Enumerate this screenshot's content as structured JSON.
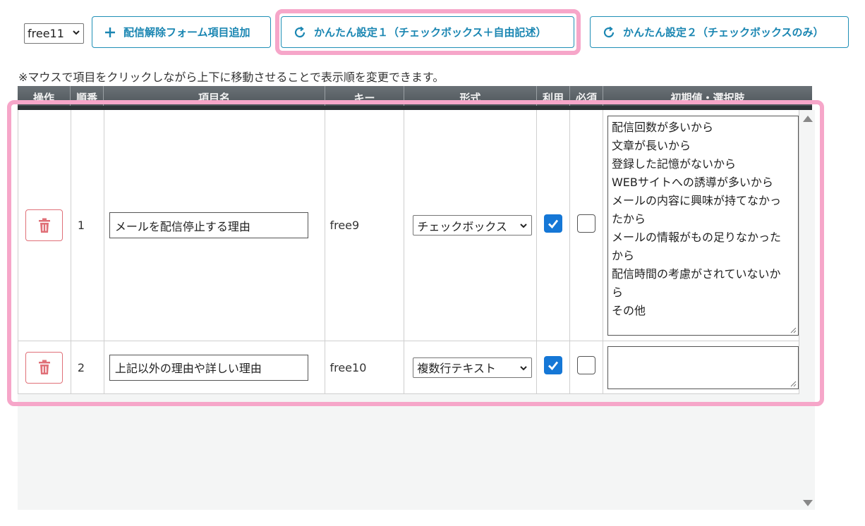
{
  "toolbar": {
    "field_select_value": "free11",
    "add_button_label": "配信解除フォーム項目追加",
    "easy1_button_label": "かんたん設定１（チェックボックス＋自由記述）",
    "easy2_button_label": "かんたん設定２（チェックボックスのみ）"
  },
  "note": "※マウスで項目をクリックしながら上下に移動させることで表示順を変更できます。",
  "table": {
    "headers": {
      "op": "操作",
      "no": "順番",
      "name": "項目名",
      "key": "キー",
      "type": "形式",
      "use": "利用",
      "required": "必須",
      "initial": "初期値・選択肢"
    },
    "rows": [
      {
        "no": "1",
        "name": "メールを配信停止する理由",
        "key": "free9",
        "type": "チェックボックス",
        "use": true,
        "required": false,
        "initial_lines": [
          "配信回数が多いから",
          "文章が長いから",
          "登録した記憶がないから",
          "WEBサイトへの誘導が多いから",
          "メールの内容に興味が持てなかっ",
          "たから",
          "メールの情報がもの足りなかった",
          "から",
          "配信時間の考慮がされていないか",
          "ら",
          "その他"
        ]
      },
      {
        "no": "2",
        "name": "上記以外の理由や詳しい理由",
        "key": "free10",
        "type": "複数行テキスト",
        "use": true,
        "required": false,
        "initial_lines": []
      }
    ]
  },
  "colors": {
    "accent": "#1a86b2",
    "highlight": "#f6a6c9",
    "delete": "#e07078",
    "checkbox": "#1577d6",
    "header": "#5a6166"
  },
  "icons": {
    "add": "plus-icon",
    "easy": "refresh-icon",
    "delete": "trash-icon",
    "check": "check-icon",
    "chevron": "chevron-down-icon"
  }
}
